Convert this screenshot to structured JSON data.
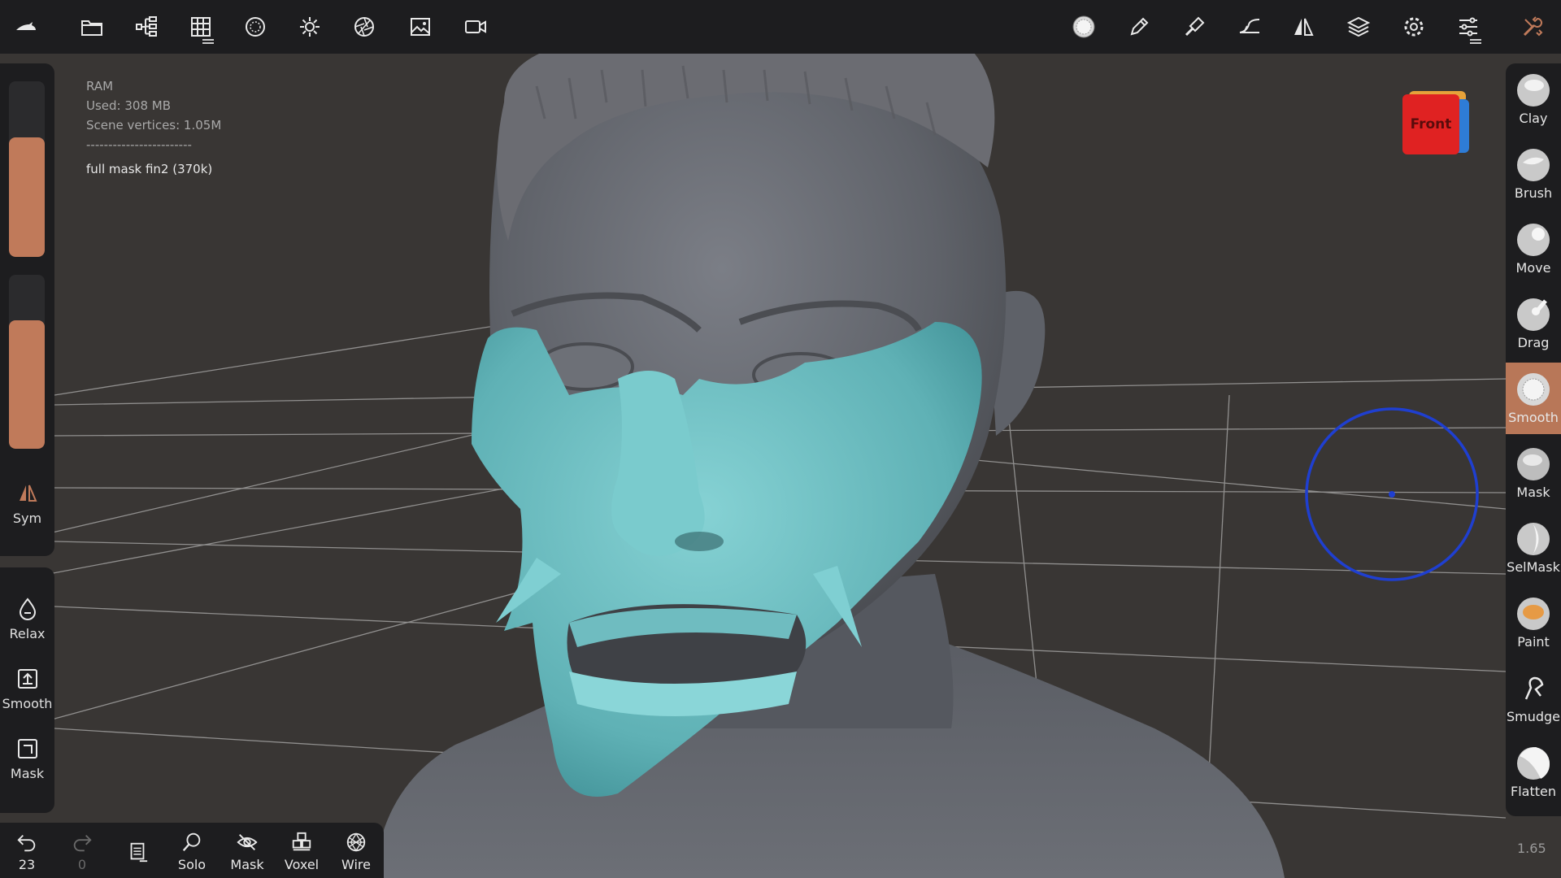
{
  "info": {
    "ram_label": "RAM",
    "used": "Used: 308 MB",
    "vertices": "Scene vertices: 1.05M",
    "separator": "------------------------",
    "model": "full mask fin2 (370k)"
  },
  "sliders": {
    "radius": 0.68,
    "intensity": 0.74
  },
  "left": {
    "sym_label": "Sym"
  },
  "tools_left": {
    "relax": "Relax",
    "smooth": "Smooth",
    "mask": "Mask"
  },
  "bottom": {
    "undo_count": "23",
    "redo_count": "0",
    "solo": "Solo",
    "mask": "Mask",
    "voxel": "Voxel",
    "wire": "Wire"
  },
  "view_cube": {
    "face": "Front"
  },
  "brushes": [
    {
      "label": "Clay"
    },
    {
      "label": "Brush"
    },
    {
      "label": "Move"
    },
    {
      "label": "Drag"
    },
    {
      "label": "Smooth"
    },
    {
      "label": "Mask"
    },
    {
      "label": "SelMask"
    },
    {
      "label": "Paint"
    },
    {
      "label": "Smudge"
    },
    {
      "label": "Flatten"
    }
  ],
  "zoom": "1.65",
  "colors": {
    "accent": "#b87758",
    "mask_teal": "#6fbcc0",
    "cursor": "#1f3fd0"
  }
}
